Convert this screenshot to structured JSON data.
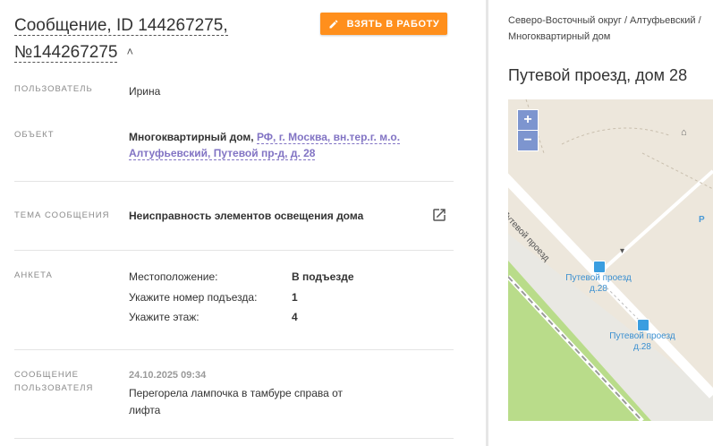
{
  "header": {
    "title": "Сообщение, ID 144267275, №144267275",
    "take_button": "ВЗЯТЬ В РАБОТУ"
  },
  "fields": {
    "user_label": "ПОЛЬЗОВАТЕЛЬ",
    "user_value": "Ирина",
    "object_label": "ОБЪЕКТ",
    "object_type": "Многоквартирный дом,",
    "object_address": "РФ, г. Москва, вн.тер.г. м.о. Алтуфьевский, Путевой пр-д, д. 28",
    "topic_label": "ТЕМА СООБЩЕНИЯ",
    "topic_value": "Неисправность элементов освещения дома",
    "survey_label": "АНКЕТА",
    "survey": [
      {
        "key": "Местоположение:",
        "value": "В подъезде"
      },
      {
        "key": "Укажите номер подъезда:",
        "value": "1"
      },
      {
        "key": "Укажите этаж:",
        "value": "4"
      }
    ],
    "message_label_1": "СООБЩЕНИЕ",
    "message_label_2": "ПОЛЬЗОВАТЕЛЯ",
    "message_date": "24.10.2025 09:34",
    "message_text": "Перегорела лампочка в тамбуре справа от лифта"
  },
  "right_panel": {
    "breadcrumb_1": "Северо-Восточный округ / Алтуфьевский /",
    "breadcrumb_2": "Многоквартирный дом",
    "address_title": "Путевой проезд, дом 28",
    "map": {
      "zoom_in": "+",
      "zoom_out": "−",
      "street_label": "Путевой проезд",
      "stop1_name": "Путевой проезд",
      "stop1_sub": "д.28",
      "stop2_name": "Путевой проезд",
      "stop2_sub": "д.28",
      "parking": "P",
      "colors": {
        "land": "#ede7dc",
        "road": "#ffffff",
        "park": "#b9dc8a",
        "stop": "#3a9ee0"
      }
    }
  }
}
